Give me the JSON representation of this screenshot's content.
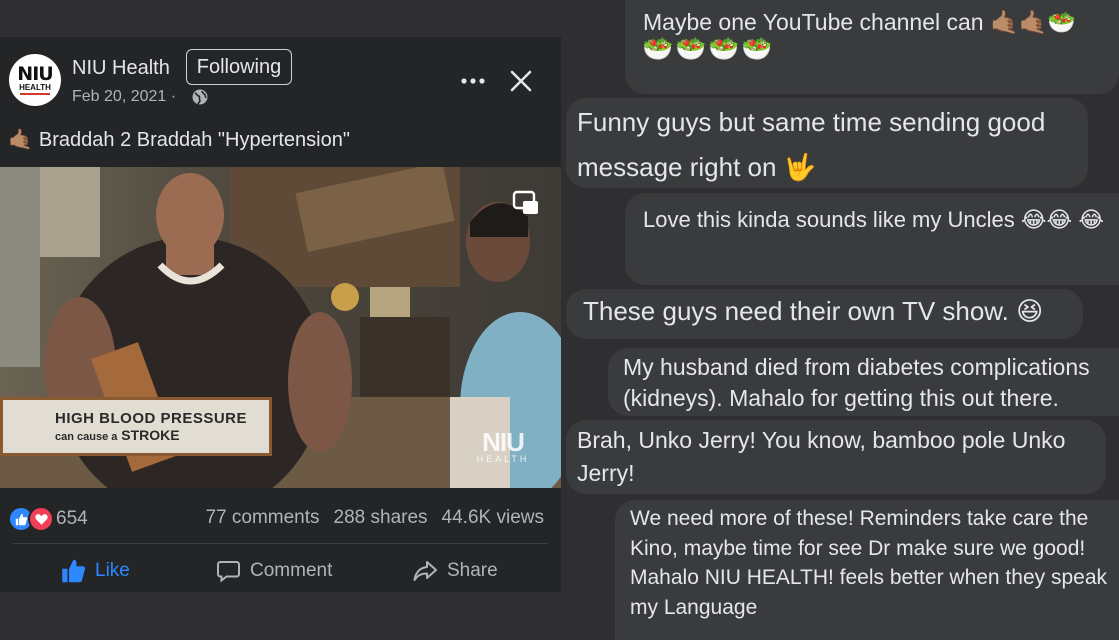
{
  "post": {
    "page_name": "NIU Health",
    "follow_label": "Following",
    "date": "Feb 20, 2021 ·",
    "avatar_logo_top": "NIU",
    "avatar_logo_bottom": "HEALTH",
    "caption_emoji": "🤙🏽",
    "caption": "Braddah 2 Braddah \"Hypertension\"",
    "video": {
      "lower_third_line1": "HIGH BLOOD PRESSURE",
      "lower_third_line2_prefix": "can cause a",
      "lower_third_line2_emphasis": "STROKE",
      "watermark_top": "NIU",
      "watermark_bottom": "HEALTH"
    },
    "reaction_count": "654",
    "comments_count": "77 comments",
    "shares_count": "288 shares",
    "views_count": "44.6K views",
    "actions": {
      "like": "Like",
      "comment": "Comment",
      "share": "Share"
    },
    "colors": {
      "accent": "#2d88ff",
      "love": "#f33e58",
      "card": "#242526",
      "bubble": "#3a3b3c"
    }
  },
  "comments": [
    {
      "line1": "Maybe one YouTube channel can 🤙🏽🤙🏽🥗",
      "line2": "🥗🥗🥗🥗"
    },
    {
      "text": "Funny guys but same time  sending good message right on 🤟"
    },
    {
      "text": "Love this kinda sounds like my Uncles 😂😂 😂"
    },
    {
      "text": "These guys need their own TV show. 😆"
    },
    {
      "text": "My husband died from diabetes complications (kidneys). Mahalo for getting this out there."
    },
    {
      "text": "Brah, Unko Jerry! You know, bamboo pole Unko Jerry!"
    },
    {
      "text": "We need more of these! Reminders take care the Kino, maybe time for see Dr make sure we good! Mahalo NIU HEALTH! feels better when they speak my Language"
    }
  ]
}
